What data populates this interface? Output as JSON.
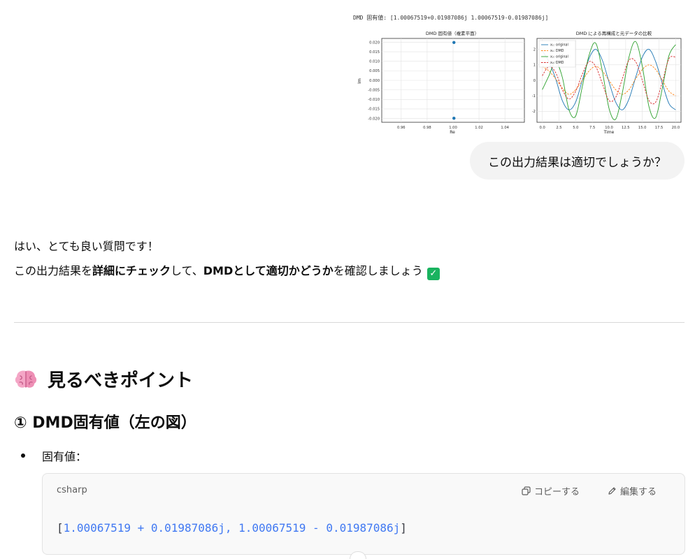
{
  "figure": {
    "title": "DMD 固有値: [1.00067519+0.01987086j 1.00067519-0.01987086j]",
    "left_plot": {
      "title": "DMD 固有値（複素平面）",
      "xlabel": "Re",
      "ylabel": "Im",
      "x_ticks": [
        "0.96",
        "0.98",
        "1.00",
        "1.02",
        "1.04"
      ],
      "y_ticks": [
        "0.020",
        "0.015",
        "0.010",
        "0.005",
        "0.000",
        "-0.005",
        "-0.010",
        "-0.015",
        "-0.020"
      ]
    },
    "right_plot": {
      "title": "DMD による再構成と元データの比較",
      "xlabel": "Time",
      "x_ticks": [
        "0.0",
        "2.5",
        "5.0",
        "7.5",
        "10.0",
        "12.5",
        "15.0",
        "17.5",
        "20.0"
      ],
      "y_ticks": [
        "2",
        "1",
        "0",
        "-1",
        "-2"
      ],
      "legend": [
        "x₁: original",
        "x₁: DMD",
        "x₂: original",
        "x₂: DMD"
      ]
    }
  },
  "chart_data": [
    {
      "type": "scatter",
      "title": "DMD 固有値（複素平面）",
      "xlabel": "Re",
      "ylabel": "Im",
      "xlim": [
        0.945,
        1.055
      ],
      "ylim": [
        -0.022,
        0.022
      ],
      "grid": true,
      "points": [
        {
          "x": 1.00067519,
          "y": 0.01987086
        },
        {
          "x": 1.00067519,
          "y": -0.01987086
        }
      ],
      "color": "#1f77b4"
    },
    {
      "type": "line",
      "title": "DMD による再構成と元データの比較",
      "xlabel": "Time",
      "ylabel": "",
      "xlim": [
        -0.8,
        20.8
      ],
      "ylim": [
        -2.7,
        2.7
      ],
      "grid": true,
      "legend_position": "top-left",
      "x": [
        0,
        1,
        2,
        3,
        4,
        5,
        6,
        7,
        8,
        9,
        10,
        11,
        12,
        13,
        14,
        15,
        16,
        17,
        18,
        19,
        20
      ],
      "series": [
        {
          "name": "x₁: original",
          "color": "#1f77b4",
          "dash": false,
          "values": [
            1.9,
            1.2,
            0.1,
            -1.3,
            -1.9,
            -1.4,
            0.0,
            1.4,
            2.0,
            1.3,
            -0.1,
            -1.4,
            -1.9,
            -1.2,
            0.2,
            1.5,
            2.0,
            1.2,
            -0.2,
            -1.5,
            -1.9
          ]
        },
        {
          "name": "x₁: DMD",
          "color": "#ff7f0e",
          "dash": true,
          "values": [
            0.9,
            0.6,
            0.1,
            -0.5,
            -0.9,
            -0.6,
            0.0,
            0.6,
            0.9,
            0.6,
            0.0,
            -0.6,
            -0.9,
            -0.6,
            0.1,
            0.7,
            1.0,
            0.7,
            0.0,
            -0.7,
            -1.0
          ]
        },
        {
          "name": "x₂: original",
          "color": "#2ca02c",
          "dash": false,
          "values": [
            -0.6,
            0.3,
            1.2,
            0.2,
            -1.9,
            -2.3,
            -0.4,
            1.6,
            2.4,
            0.6,
            -1.8,
            -2.5,
            -0.8,
            1.5,
            2.5,
            0.9,
            -1.7,
            -2.4,
            -0.5,
            1.6,
            2.3
          ]
        },
        {
          "name": "x₂: DMD",
          "color": "#d62728",
          "dash": true,
          "values": [
            0.3,
            0.9,
            0.5,
            -0.6,
            -1.2,
            -0.7,
            0.4,
            1.2,
            0.9,
            -0.2,
            -1.3,
            -1.1,
            0.1,
            1.3,
            1.2,
            0.0,
            -1.3,
            -1.4,
            -0.1,
            1.4,
            1.5
          ]
        }
      ]
    }
  ],
  "user_message": "この出力結果は適切でしょうか？",
  "answer": {
    "line1": "はい、とても良い質問です！",
    "line2_part1": "この出力結果を",
    "line2_bold1": "詳細にチェック",
    "line2_part2": "して、",
    "line2_bold2": "DMDとして適切かどうか",
    "line2_part3": "を確認しましょう",
    "check_emoji": "✓",
    "section_heading": "見るべきポイント",
    "sub_heading": "① DMD固有値（左の図）",
    "bullet_label": "固有値：",
    "code": {
      "language": "csharp",
      "copy_label": "コピーする",
      "edit_label": "編集する",
      "open_bracket": "[",
      "value1": "1.00067519 + 0.01987086j",
      "separator": ", ",
      "value2": "1.00067519 - 0.01987086j",
      "close_bracket": "]"
    }
  },
  "colors": {
    "bubble_bg": "#f3f3f3",
    "check_green": "#19b35f",
    "code_number": "#4078f2",
    "divider": "#d9d9d9"
  }
}
